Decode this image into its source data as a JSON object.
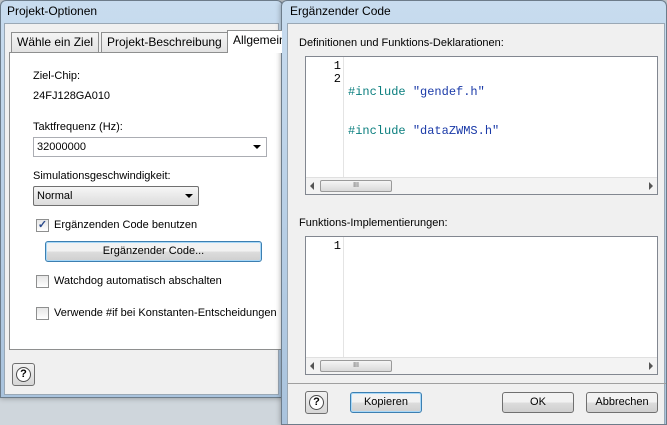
{
  "project_window": {
    "title": "Projekt-Optionen",
    "tabs": [
      "Wähle ein Ziel",
      "Projekt-Beschreibung",
      "Allgemein"
    ],
    "target_chip_label": "Ziel-Chip:",
    "target_chip_value": "24FJ128GA010",
    "clock_label": "Taktfrequenz (Hz):",
    "clock_value": "32000000",
    "sim_speed_label": "Simulationsgeschwindigkeit:",
    "sim_speed_value": "Normal",
    "use_extra_code_label": "Ergänzenden Code benutzen",
    "use_extra_code_checked": true,
    "extra_code_button": "Ergänzender Code...",
    "watchdog_label": "Watchdog automatisch abschalten",
    "watchdog_checked": false,
    "use_if_label": "Verwende #if bei Konstanten-Entscheidungen",
    "use_if_checked": false,
    "help_icon": "help-icon"
  },
  "code_window": {
    "title": "Ergänzender Code",
    "definitions_label": "Definitionen und Funktions-Deklarationen:",
    "definitions_lines": [
      {
        "num": "1",
        "keyword": "#include",
        "string": "\"gendef.h\""
      },
      {
        "num": "2",
        "keyword": "#include",
        "string": "\"dataZWMS.h\""
      }
    ],
    "implementations_label": "Funktions-Implementierungen:",
    "implementations_lines": [
      {
        "num": "1"
      }
    ],
    "scroll_thumb_grip": "III",
    "copy_button": "Kopieren",
    "ok_button": "OK",
    "cancel_button": "Abbrechen",
    "help_icon": "help-icon"
  }
}
